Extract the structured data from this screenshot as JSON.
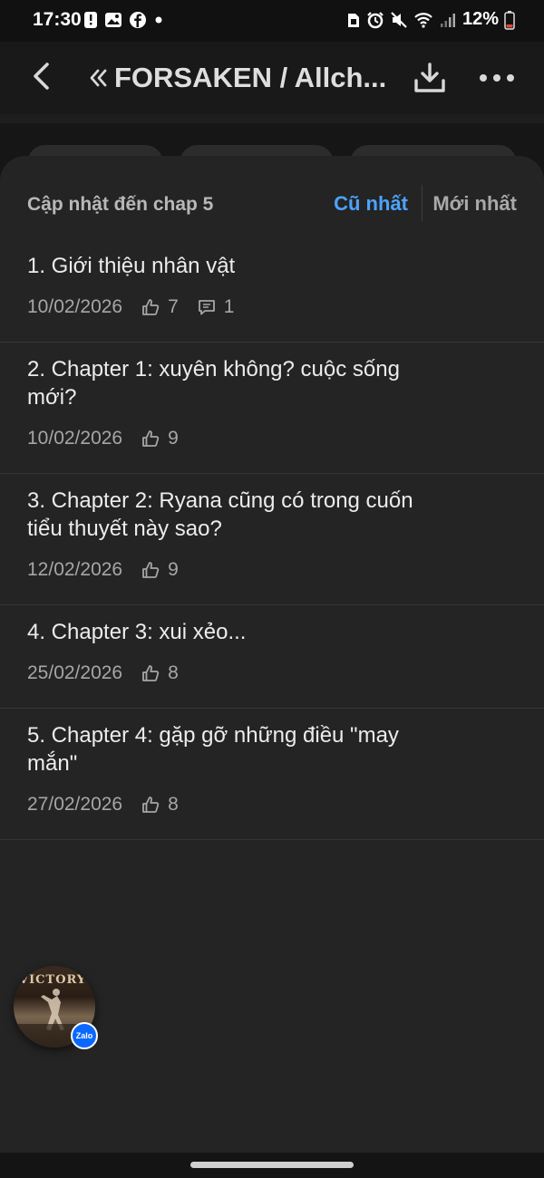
{
  "status_bar": {
    "time": "17:30",
    "battery": "12%"
  },
  "header": {
    "title": "FORSAKEN / Allch..."
  },
  "sheet": {
    "update_label": "Cập nhật đến chap 5",
    "sort_oldest": "Cũ nhất",
    "sort_newest": "Mới nhất"
  },
  "chapters": [
    {
      "title": "1. Giới thiệu nhân vật",
      "date": "10/02/2026",
      "likes": "7",
      "comments": "1"
    },
    {
      "title": "2. Chapter 1: xuyên không? cuộc sống mới?",
      "date": "10/02/2026",
      "likes": "9"
    },
    {
      "title": "3. Chapter 2: Ryana cũng có trong cuốn tiểu thuyết này sao?",
      "date": "12/02/2026",
      "likes": "9"
    },
    {
      "title": "4. Chapter 3: xui xẻo...",
      "date": "25/02/2026",
      "likes": "8"
    },
    {
      "title": "5. Chapter 4: gặp gỡ những điều \"may mắn\"",
      "date": "27/02/2026",
      "likes": "8"
    }
  ],
  "chat_bubble": {
    "image_text": "VICTORY",
    "badge": "Zalo"
  },
  "colors": {
    "accent": "#4da3ff",
    "sheet_bg": "#242424",
    "text": "#ececec",
    "muted": "#a6a6a6"
  }
}
